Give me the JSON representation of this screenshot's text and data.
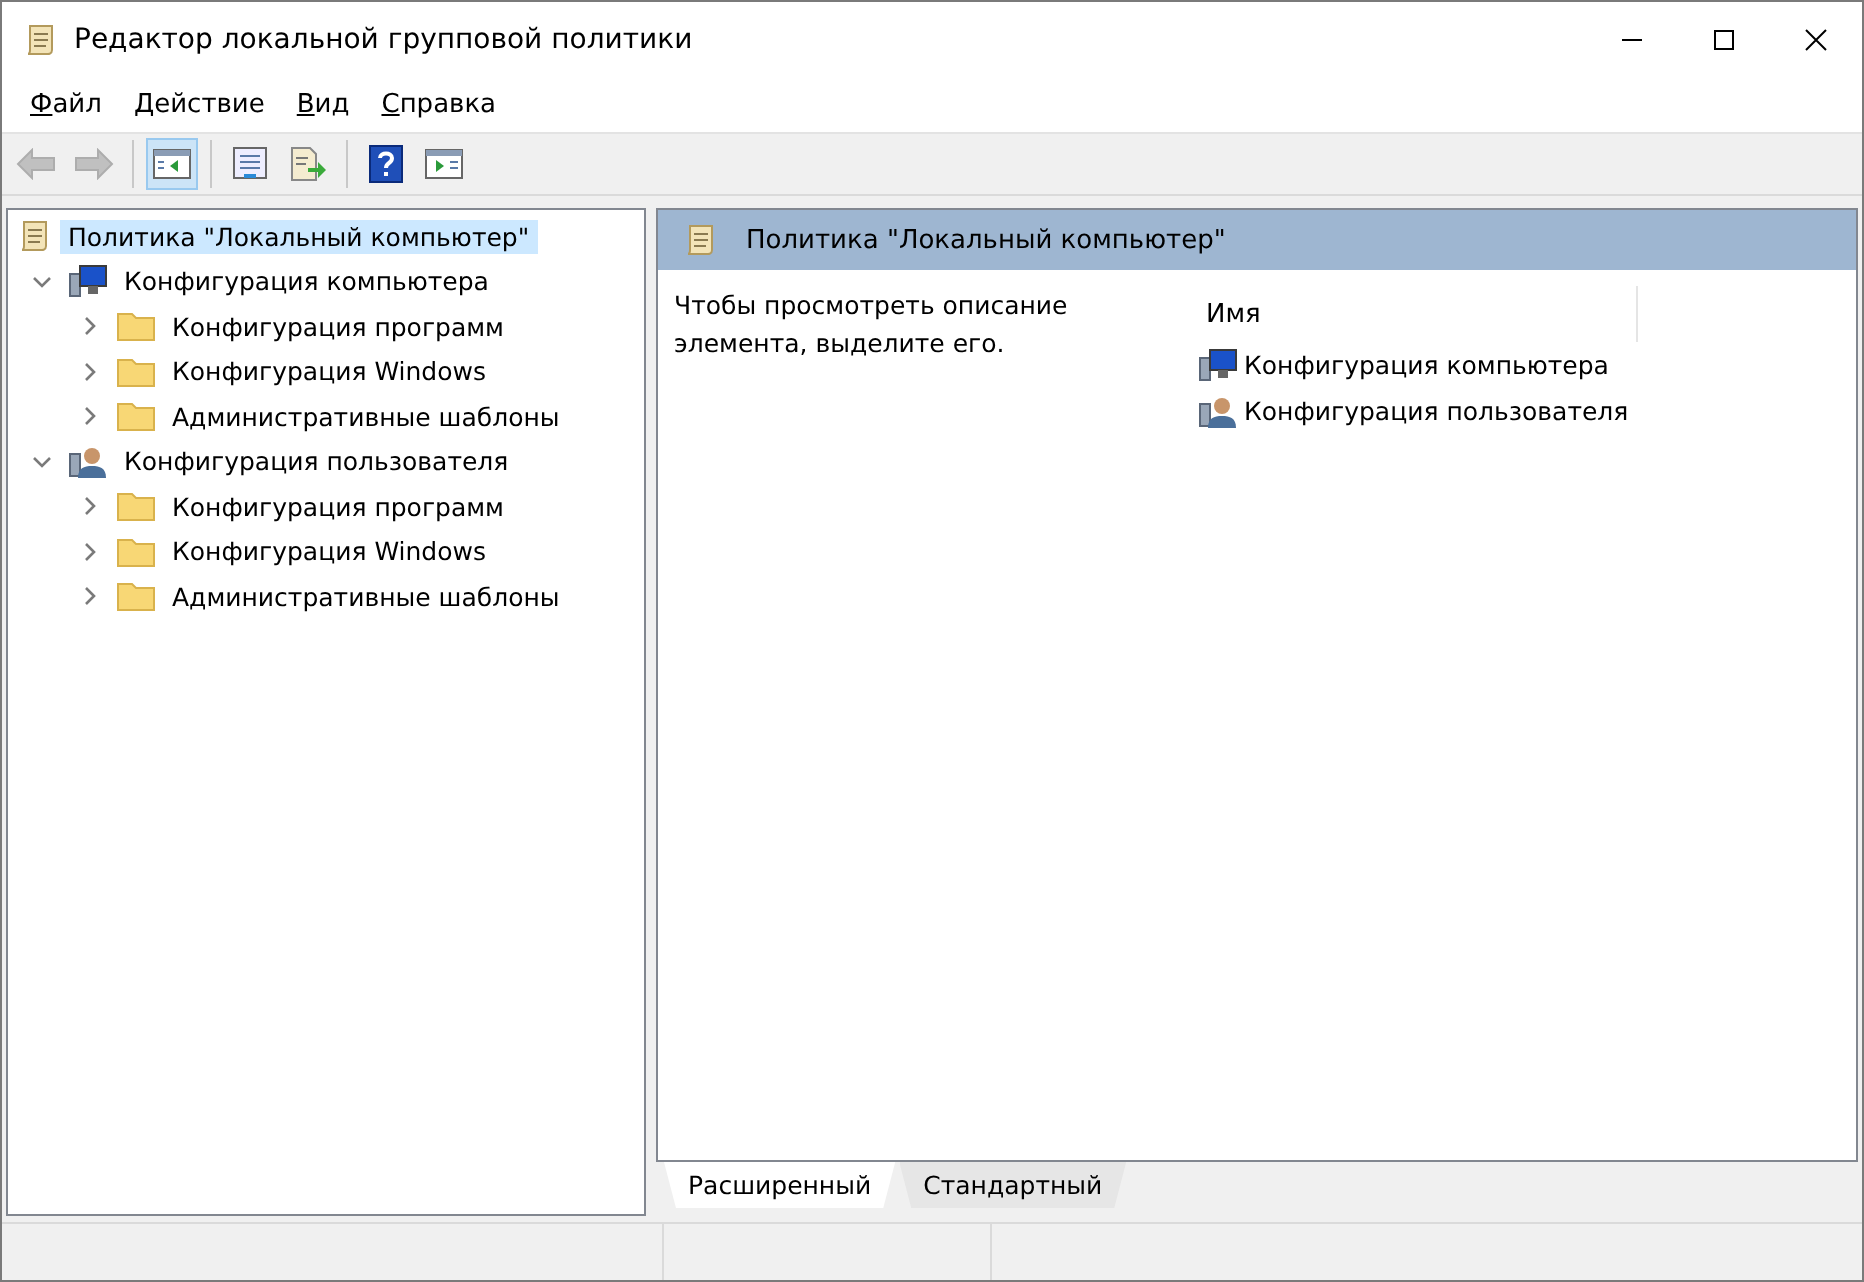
{
  "window": {
    "title": "Редактор локальной групповой политики"
  },
  "menu": [
    "Файл",
    "Действие",
    "Вид",
    "Справка"
  ],
  "toolbar": [
    {
      "kind": "back",
      "disabled": true,
      "pressed": false
    },
    {
      "kind": "forward",
      "disabled": true,
      "pressed": false
    },
    {
      "kind": "separator"
    },
    {
      "kind": "tree",
      "disabled": false,
      "pressed": true
    },
    {
      "kind": "separator"
    },
    {
      "kind": "properties",
      "disabled": false,
      "pressed": false
    },
    {
      "kind": "export",
      "disabled": false,
      "pressed": false
    },
    {
      "kind": "separator"
    },
    {
      "kind": "help",
      "disabled": false,
      "pressed": false
    },
    {
      "kind": "actionpane",
      "disabled": false,
      "pressed": false
    }
  ],
  "tree": [
    {
      "label": "Политика \"Локальный компьютер\"",
      "kind": "scroll",
      "selected": true,
      "children": [
        {
          "label": "Конфигурация компьютера",
          "kind": "computer",
          "expanded": true,
          "selected": false,
          "children": [
            {
              "label": "Конфигурация программ",
              "kind": "folder",
              "expanded": false,
              "selected": false
            },
            {
              "label": "Конфигурация Windows",
              "kind": "folder",
              "expanded": false,
              "selected": false
            },
            {
              "label": "Административные шаблоны",
              "kind": "folder",
              "expanded": false,
              "selected": false
            }
          ]
        },
        {
          "label": "Конфигурация пользователя",
          "kind": "user",
          "expanded": true,
          "selected": false,
          "children": [
            {
              "label": "Конфигурация программ",
              "kind": "folder",
              "expanded": false,
              "selected": false
            },
            {
              "label": "Конфигурация Windows",
              "kind": "folder",
              "expanded": false,
              "selected": false
            },
            {
              "label": "Административные шаблоны",
              "kind": "folder",
              "expanded": false,
              "selected": false
            }
          ]
        }
      ]
    }
  ],
  "details": {
    "header": "Политика \"Локальный компьютер\"",
    "description": "Чтобы просмотреть описание элемента, выделите его.",
    "column": "Имя",
    "items": [
      {
        "label": "Конфигурация компьютера",
        "kind": "computer"
      },
      {
        "label": "Конфигурация пользователя",
        "kind": "user"
      }
    ]
  },
  "tabs": [
    {
      "label": "Расширенный",
      "selected": true
    },
    {
      "label": "Стандартный",
      "selected": false
    }
  ]
}
